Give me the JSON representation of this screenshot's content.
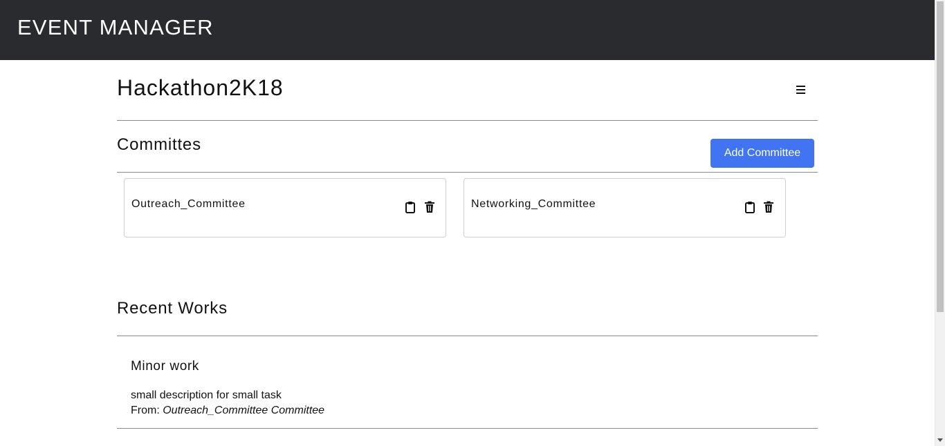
{
  "navbar": {
    "brand": "EVENT MANAGER"
  },
  "event": {
    "title": "Hackathon2K18"
  },
  "committees": {
    "heading": "Committes",
    "add_button_label": "Add Committee",
    "items": [
      {
        "name": "Outreach_Committee",
        "icons": [
          "clipboard-icon",
          "trash-icon"
        ]
      },
      {
        "name": "Networking_Committee",
        "icons": [
          "clipboard-icon",
          "trash-icon"
        ]
      }
    ]
  },
  "recent_works": {
    "heading": "Recent Works",
    "items": [
      {
        "title": "Minor work",
        "description": "small description for small task",
        "from_label": "From:",
        "from_value": "Outreach_Committee Committee"
      }
    ]
  },
  "colors": {
    "navbar_bg": "#292b2f",
    "primary_button": "#4174f0",
    "text": "#111111"
  }
}
